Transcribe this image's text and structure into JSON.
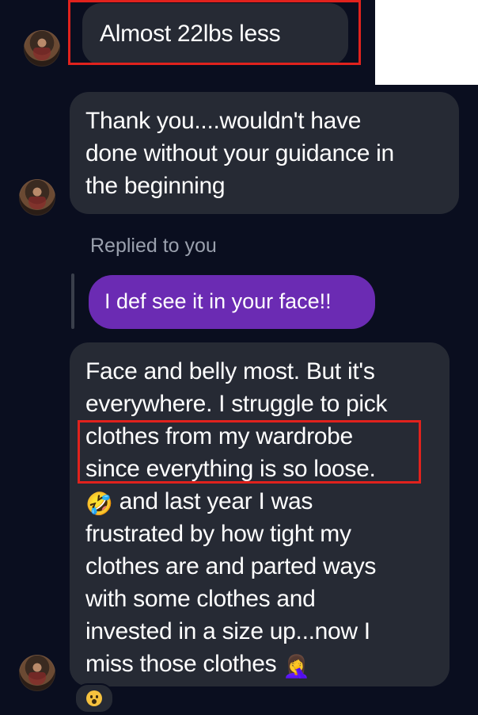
{
  "messages": {
    "m1": {
      "text": "Almost 22lbs less"
    },
    "m2": {
      "lines": [
        "Thank you....wouldn't have",
        "done without your guidance in",
        "the beginning"
      ]
    },
    "reply": {
      "label": "Replied to you",
      "quoted": "I def see it in your face!!"
    },
    "m3": {
      "lines": [
        "Face and belly most. But it's",
        "everywhere. I struggle to pick",
        "clothes from my wardrobe",
        "since everything is so loose.",
        " and last year I was",
        "frustrated by how tight my",
        "clothes are and parted ways",
        "with some clothes and",
        "invested in a size up...now I",
        "miss those clothes "
      ],
      "emoji_laughing": "🤣",
      "emoji_facepalm": "🤦‍♀️"
    },
    "reaction": {
      "icon": "astonished-face-icon"
    }
  },
  "colors": {
    "background": "#0a0e1f",
    "incoming_bubble": "#262a34",
    "outgoing_bubble": "#6b2bb3",
    "highlight": "#e0221d"
  }
}
